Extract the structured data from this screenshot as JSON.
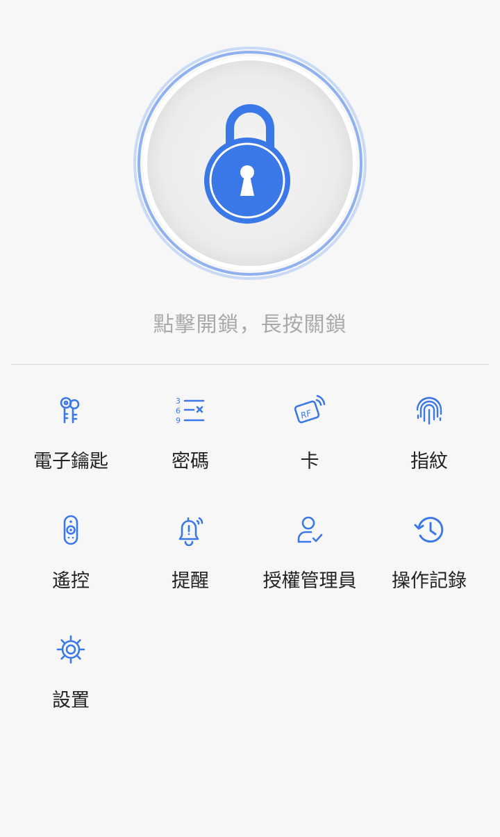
{
  "lock": {
    "hint": "點擊開鎖，長按關鎖",
    "accent_color": "#3b78e7"
  },
  "menu": [
    {
      "label": "電子鑰匙",
      "icon": "keys-icon"
    },
    {
      "label": "密碼",
      "icon": "passcode-icon"
    },
    {
      "label": "卡",
      "icon": "rf-card-icon"
    },
    {
      "label": "指紋",
      "icon": "fingerprint-icon"
    },
    {
      "label": "遙控",
      "icon": "remote-icon"
    },
    {
      "label": "提醒",
      "icon": "bell-alert-icon"
    },
    {
      "label": "授權管理員",
      "icon": "admin-user-icon"
    },
    {
      "label": "操作記錄",
      "icon": "history-icon"
    },
    {
      "label": "設置",
      "icon": "gear-icon"
    }
  ]
}
